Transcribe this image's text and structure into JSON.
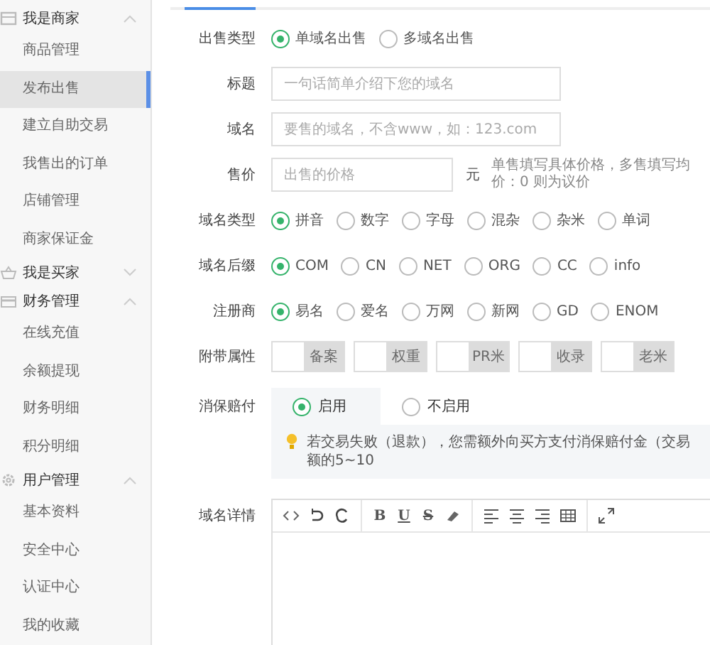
{
  "sidebar": {
    "groups": [
      {
        "title": "我是商家",
        "expanded": true,
        "items": [
          {
            "label": "商品管理",
            "selected": false
          },
          {
            "label": "发布出售",
            "selected": true
          },
          {
            "label": "建立自助交易",
            "selected": false
          },
          {
            "label": "我售出的订单",
            "selected": false
          },
          {
            "label": "店铺管理",
            "selected": false
          },
          {
            "label": "商家保证金",
            "selected": false
          }
        ]
      },
      {
        "title": "我是买家",
        "expanded": false
      },
      {
        "title": "财务管理",
        "expanded": true,
        "items": [
          {
            "label": "在线充值",
            "selected": false
          },
          {
            "label": "余额提现",
            "selected": false
          },
          {
            "label": "财务明细",
            "selected": false
          },
          {
            "label": "积分明细",
            "selected": false
          }
        ]
      },
      {
        "title": "用户管理",
        "expanded": true,
        "items": [
          {
            "label": "基本资料",
            "selected": false
          },
          {
            "label": "安全中心",
            "selected": false
          },
          {
            "label": "认证中心",
            "selected": false
          },
          {
            "label": "我的收藏",
            "selected": false
          }
        ]
      }
    ]
  },
  "form": [
    {
      "kind": "radio",
      "label": "出售类型",
      "options": [
        {
          "label": "单域名出售",
          "selected": true
        },
        {
          "label": "多域名出售",
          "selected": false
        }
      ]
    },
    {
      "kind": "input",
      "label": "标题",
      "placeholder": "一句话简单介绍下您的域名"
    },
    {
      "kind": "input",
      "label": "域名",
      "placeholder": "要售的域名，不含www，如：123.com"
    },
    {
      "kind": "price",
      "label": "售价",
      "placeholder": "出售的价格",
      "unit": "元",
      "hint": "单售填写具体价格，多售填写均价：0 则为议价"
    },
    {
      "kind": "radio",
      "label": "域名类型",
      "options": [
        {
          "label": "拼音",
          "selected": true
        },
        {
          "label": "数字",
          "selected": false
        },
        {
          "label": "字母",
          "selected": false
        },
        {
          "label": "混杂",
          "selected": false
        },
        {
          "label": "杂米",
          "selected": false
        },
        {
          "label": "单词",
          "selected": false
        }
      ]
    },
    {
      "kind": "radio",
      "label": "域名后缀",
      "options": [
        {
          "label": "COM",
          "selected": true
        },
        {
          "label": "CN",
          "selected": false
        },
        {
          "label": "NET",
          "selected": false
        },
        {
          "label": "ORG",
          "selected": false
        },
        {
          "label": "CC",
          "selected": false
        },
        {
          "label": "info",
          "selected": false
        }
      ]
    },
    {
      "kind": "radio",
      "label": "注册商",
      "options": [
        {
          "label": "易名",
          "selected": true
        },
        {
          "label": "爱名",
          "selected": false
        },
        {
          "label": "万网",
          "selected": false
        },
        {
          "label": "新网",
          "selected": false
        },
        {
          "label": "GD",
          "selected": false
        },
        {
          "label": "ENOM",
          "selected": false
        }
      ]
    },
    {
      "kind": "toggles",
      "label": "附带属性",
      "options": [
        {
          "label": "备案",
          "on": false
        },
        {
          "label": "权重",
          "on": false
        },
        {
          "label": "PR米",
          "on": false
        },
        {
          "label": "收录",
          "on": false
        },
        {
          "label": "老米",
          "on": false
        }
      ]
    },
    {
      "kind": "insurance",
      "label": "消保赔付",
      "options": [
        {
          "label": "启用",
          "selected": true
        },
        {
          "label": "不启用",
          "selected": false
        }
      ],
      "tip": "若交易失败（退款），您需额外向买方支付消保赔付金（交易额的5~10"
    },
    {
      "kind": "editor",
      "label": "域名详情",
      "format_buttons": [
        "B",
        "U",
        "S"
      ]
    }
  ]
}
